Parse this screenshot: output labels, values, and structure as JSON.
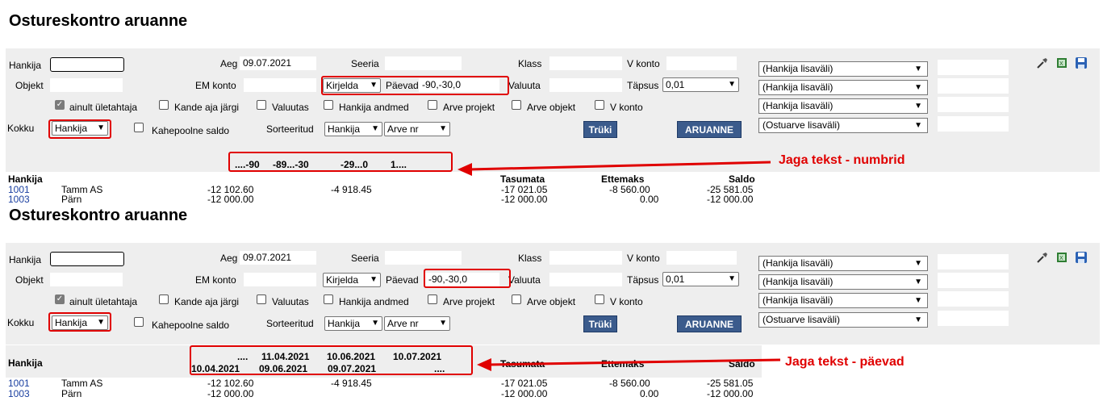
{
  "report1": {
    "title": "Ostureskontro aruanne",
    "form": {
      "hankija_label": "Hankija",
      "aeg_label": "Aeg",
      "aeg_value": "09.07.2021",
      "seeria_label": "Seeria",
      "klass_label": "Klass",
      "vkonto_label": "V konto",
      "objekt_label": "Objekt",
      "emkonto_label": "EM konto",
      "kirjelda_value": "Kirjelda",
      "paevad_label": "Päevad",
      "paevad_value": "-90,-30,0",
      "valuuta_label": "Valuuta",
      "tapsus_label": "Täpsus",
      "tapsus_value": "0,01",
      "cb_ainult": "ainult ületahtaja",
      "cb_kande": "Kande aja järgi",
      "cb_valuutas": "Valuutas",
      "cb_hankija": "Hankija andmed",
      "cb_arveprojekt": "Arve projekt",
      "cb_arveobjekt": "Arve objekt",
      "cb_vkonto": "V konto",
      "kokku_label": "Kokku",
      "kokku_value": "Hankija",
      "kahepoolne": "Kahepoolne saldo",
      "sorteeritud_label": "Sorteeritud",
      "sort1": "Hankija",
      "sort2": "Arve nr",
      "truki": "Trüki",
      "aruanne": "ARUANNE",
      "side_selects": [
        "(Hankija lisaväli)",
        "(Hankija lisaväli)",
        "(Hankija lisaväli)",
        "(Ostuarve lisaväli)"
      ]
    },
    "table": {
      "col_hankija": "Hankija",
      "buckets": [
        "....-90",
        "-89...-30",
        "-29...0",
        "1...."
      ],
      "col_tasumata": "Tasumata",
      "col_ettemaks": "Ettemaks",
      "col_saldo": "Saldo",
      "rows": [
        {
          "id": "1001",
          "name": "Tamm AS",
          "b1": "-12 102.60",
          "b3": "-4 918.45",
          "tasumata": "-17 021.05",
          "ettemaks": "-8 560.00",
          "saldo": "-25 581.05"
        },
        {
          "id": "1003",
          "name": "Pärn",
          "b1": "-12 000.00",
          "b3": "",
          "tasumata": "-12 000.00",
          "ettemaks": "0.00",
          "saldo": "-12 000.00"
        }
      ]
    },
    "annotation": "Jaga tekst - numbrid"
  },
  "report2": {
    "title": "Ostureskontro aruanne",
    "form": {
      "hankija_label": "Hankija",
      "aeg_label": "Aeg",
      "aeg_value": "09.07.2021",
      "seeria_label": "Seeria",
      "klass_label": "Klass",
      "vkonto_label": "V konto",
      "objekt_label": "Objekt",
      "emkonto_label": "EM konto",
      "kirjelda_value": "Kirjelda",
      "paevad_label": "Päevad",
      "paevad_value": "-90,-30,0",
      "valuuta_label": "Valuuta",
      "tapsus_label": "Täpsus",
      "tapsus_value": "0,01",
      "cb_ainult": "ainult ületahtaja",
      "cb_kande": "Kande aja järgi",
      "cb_valuutas": "Valuutas",
      "cb_hankija": "Hankija andmed",
      "cb_arveprojekt": "Arve projekt",
      "cb_arveobjekt": "Arve objekt",
      "cb_vkonto": "V konto",
      "kokku_label": "Kokku",
      "kokku_value": "Hankija",
      "kahepoolne": "Kahepoolne saldo",
      "sorteeritud_label": "Sorteeritud",
      "sort1": "Hankija",
      "sort2": "Arve nr",
      "truki": "Trüki",
      "aruanne": "ARUANNE",
      "side_selects": [
        "(Hankija lisaväli)",
        "(Hankija lisaväli)",
        "(Hankija lisaväli)",
        "(Ostuarve lisaväli)"
      ]
    },
    "table": {
      "col_hankija": "Hankija",
      "bucket_top": [
        "....",
        "11.04.2021",
        "10.06.2021",
        "10.07.2021"
      ],
      "bucket_bottom": [
        "10.04.2021",
        "09.06.2021",
        "09.07.2021",
        "...."
      ],
      "col_tasumata": "Tasumata",
      "col_ettemaks": "Ettemaks",
      "col_saldo": "Saldo",
      "rows": [
        {
          "id": "1001",
          "name": "Tamm AS",
          "b1": "-12 102.60",
          "b3": "-4 918.45",
          "tasumata": "-17 021.05",
          "ettemaks": "-8 560.00",
          "saldo": "-25 581.05"
        },
        {
          "id": "1003",
          "name": "Pärn",
          "b1": "-12 000.00",
          "b3": "",
          "tasumata": "-12 000.00",
          "ettemaks": "0.00",
          "saldo": "-12 000.00"
        }
      ]
    },
    "annotation": "Jaga tekst - päevad"
  }
}
